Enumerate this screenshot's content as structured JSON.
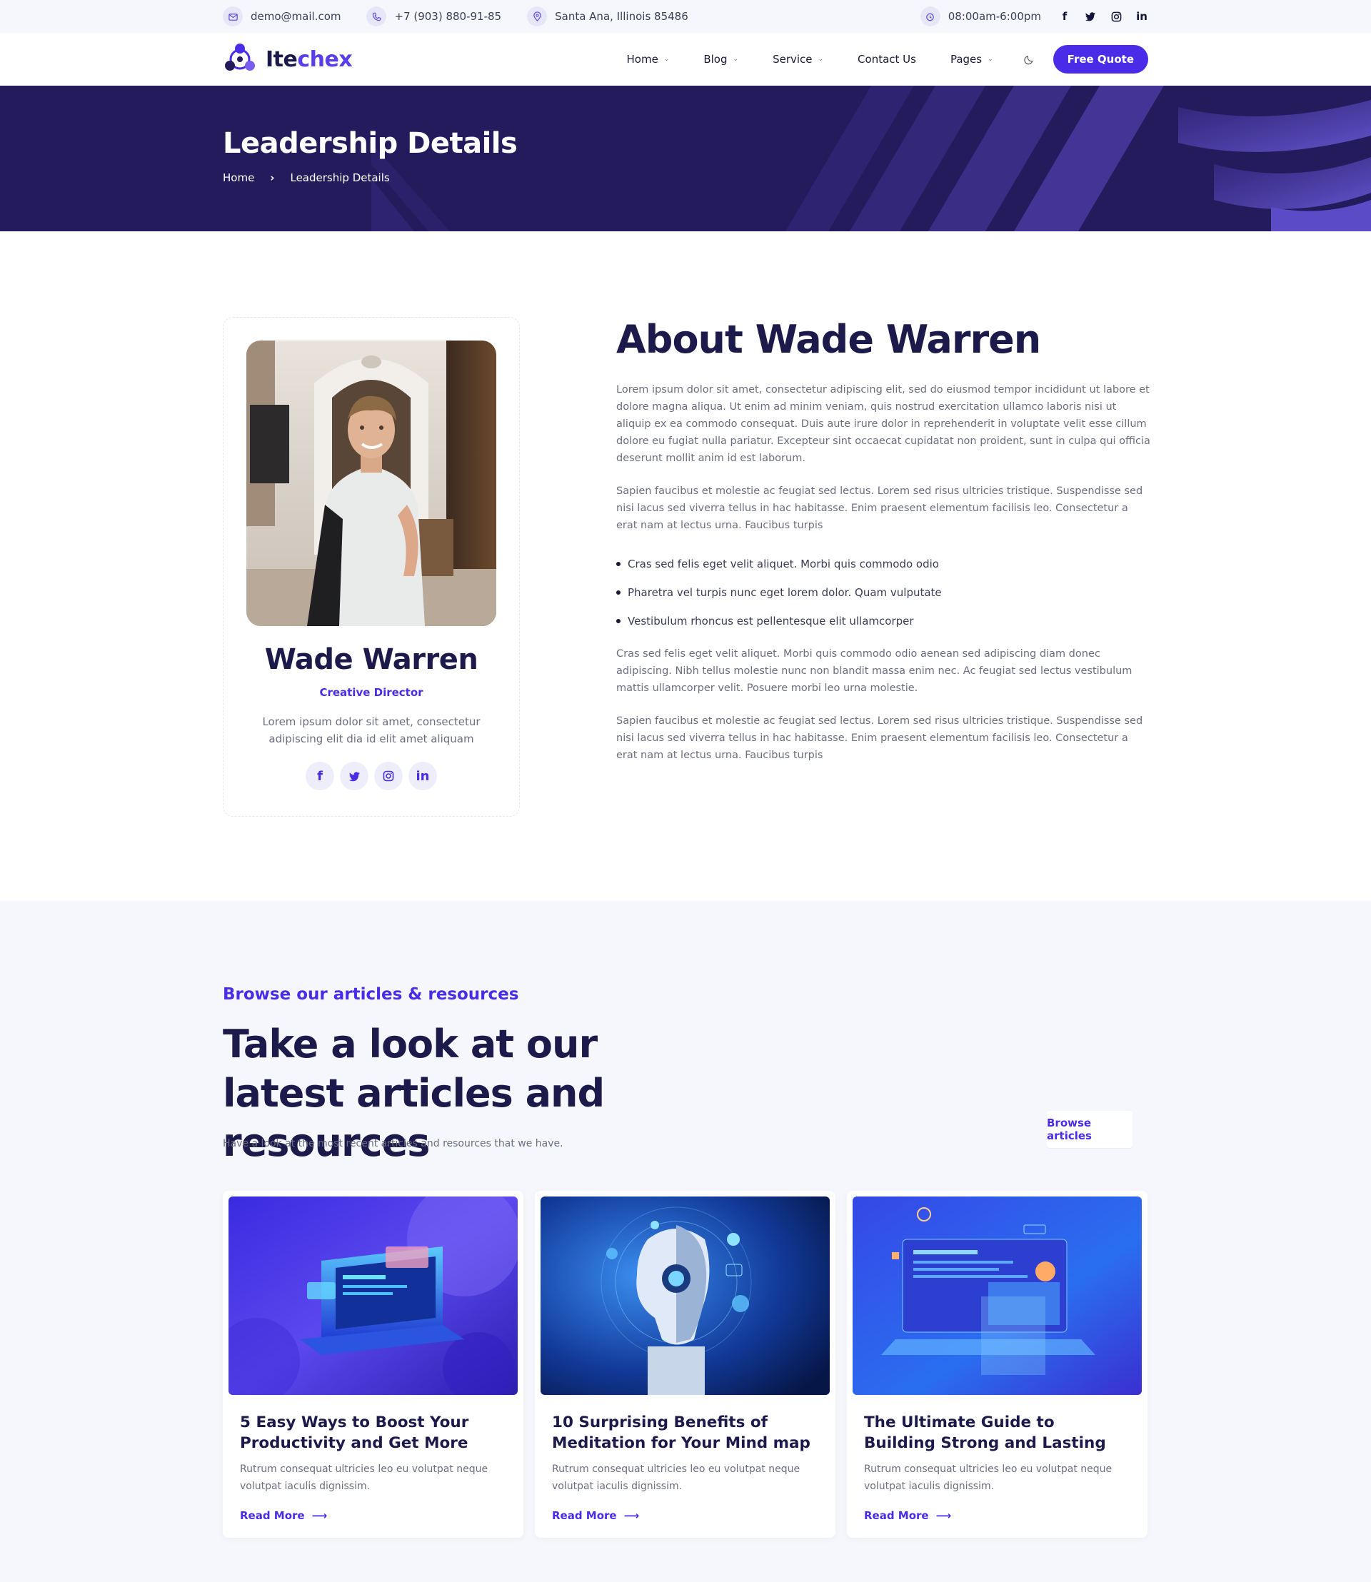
{
  "topbar": {
    "email": "demo@mail.com",
    "phone": "+7 (903) 880-91-85",
    "address": "Santa Ana, Illinois 85486",
    "hours": "08:00am-6:00pm",
    "social": [
      "facebook-icon",
      "twitter-icon",
      "instagram-icon",
      "linkedin-icon"
    ]
  },
  "header": {
    "logo_part1": "Ite",
    "logo_part2": "chex",
    "nav": [
      "Home",
      "Blog",
      "Service",
      "Contact Us",
      "Pages"
    ],
    "cta": "Free Quote"
  },
  "hero": {
    "title": "Leadership Details",
    "breadcrumb_home": "Home",
    "breadcrumb_current": "Leadership Details"
  },
  "profile": {
    "name": "Wade Warren",
    "role": "Creative Director",
    "description": "Lorem ipsum dolor sit amet, consectetur adipiscing elit dia id elit amet aliquam"
  },
  "about": {
    "title": "About Wade Warren",
    "p1": "Lorem ipsum dolor sit amet, consectetur adipiscing elit, sed do eiusmod tempor incididunt ut labore et dolore magna aliqua. Ut enim ad minim veniam, quis nostrud exercitation ullamco laboris nisi ut aliquip ex ea commodo consequat. Duis aute irure dolor in reprehenderit in voluptate velit esse cillum dolore eu fugiat nulla pariatur. Excepteur sint occaecat cupidatat non proident, sunt in culpa qui officia deserunt mollit anim id est laborum.",
    "p2": "Sapien faucibus et molestie ac feugiat sed lectus. Lorem sed risus ultricies tristique. Suspendisse sed nisi lacus sed viverra tellus in hac habitasse. Enim praesent elementum facilisis leo. Consectetur a erat nam at lectus urna. Faucibus turpis",
    "bullets": [
      "Cras sed felis eget velit aliquet. Morbi quis commodo odio",
      "Pharetra vel turpis nunc eget lorem dolor. Quam vulputate",
      "Vestibulum rhoncus est pellentesque elit ullamcorper"
    ],
    "p3": "Cras sed felis eget velit aliquet. Morbi quis commodo odio aenean sed adipiscing diam donec adipiscing. Nibh tellus molestie nunc non blandit massa enim nec. Ac feugiat sed lectus vestibulum mattis ullamcorper velit. Posuere morbi leo urna molestie.",
    "p4": "Sapien faucibus et molestie ac feugiat sed lectus. Lorem sed risus ultricies tristique. Suspendisse sed nisi lacus sed viverra tellus in hac habitasse. Enim praesent elementum facilisis leo. Consectetur a erat nam at lectus urna. Faucibus turpis"
  },
  "articles": {
    "eyebrow": "Browse our articles & resources",
    "title": "Take a look at our latest articles and resources",
    "subtitle": "Have a look at the most recent articles and resources that we have.",
    "browse": "Browse articles",
    "cards": [
      {
        "title": "5 Easy Ways to Boost Your Productivity and Get More",
        "excerpt": "Rutrum consequat ultricies leo eu volutpat neque volutpat iaculis dignissim.",
        "more": "Read More"
      },
      {
        "title": "10 Surprising Benefits of Meditation for Your Mind map",
        "excerpt": "Rutrum consequat ultricies leo eu volutpat neque volutpat iaculis dignissim.",
        "more": "Read More"
      },
      {
        "title": "The Ultimate Guide to Building Strong and Lasting",
        "excerpt": "Rutrum consequat ultricies leo eu volutpat neque volutpat iaculis dignissim.",
        "more": "Read More"
      }
    ]
  },
  "colors": {
    "primary": "#4a2ce8",
    "hero_bg": "#241b5c",
    "heading": "#1b1a4a",
    "text": "#6b6d80"
  }
}
